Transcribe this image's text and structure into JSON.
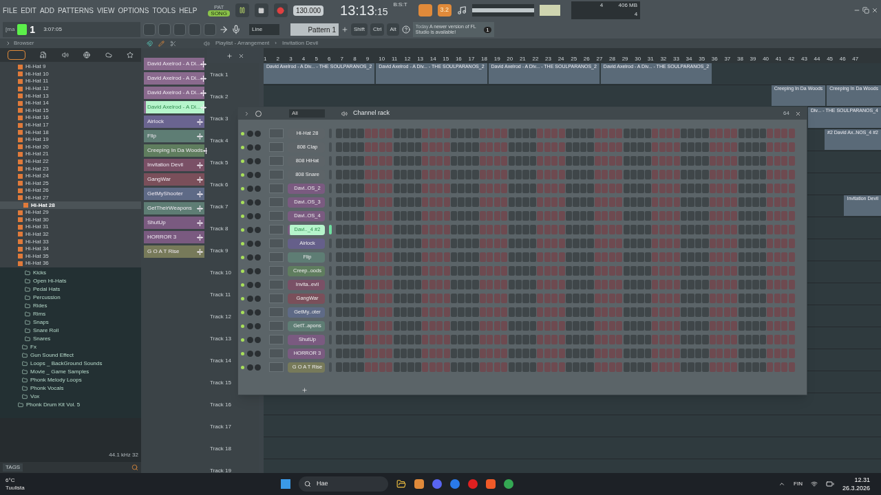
{
  "menu": [
    "FILE",
    "EDIT",
    "ADD",
    "PATTERNS",
    "VIEW",
    "OPTIONS",
    "TOOLS",
    "HELP"
  ],
  "transport": {
    "pat_label": "PAT",
    "song_label": "SONG",
    "song_mode": true,
    "tempo": "130.000",
    "time": "13:13",
    "time_small": ":15",
    "time_unit": "B:S:T",
    "step_label": "3.2"
  },
  "monitor": {
    "cpu": "4",
    "memory": "406 MB",
    "polyphony": "4"
  },
  "hint": {
    "text": "[ma",
    "time": "3:07:05",
    "logo_number": "1"
  },
  "toolbar": {
    "snap": "Line",
    "pattern": "Pattern 1",
    "keys": [
      "Shift",
      "Ctrl",
      "Alt"
    ]
  },
  "news": {
    "when": "Today",
    "text": "A newer version of FL Studio is available!",
    "badge": "1"
  },
  "browser": {
    "title": "Browser",
    "files": [
      {
        "label": "Hi-Hat 9",
        "selected": false
      },
      {
        "label": "Hi-Hat 10",
        "selected": false
      },
      {
        "label": "Hi-Hat 11",
        "selected": false
      },
      {
        "label": "Hi-Hat 12",
        "selected": false
      },
      {
        "label": "Hi-Hat 13",
        "selected": false
      },
      {
        "label": "Hi-Hat 14",
        "selected": false
      },
      {
        "label": "Hi-Hat 15",
        "selected": false
      },
      {
        "label": "Hi-Hat 16",
        "selected": false
      },
      {
        "label": "Hi-Hat 17",
        "selected": false
      },
      {
        "label": "Hi-Hat 18",
        "selected": false
      },
      {
        "label": "Hi-Hat 19",
        "selected": false
      },
      {
        "label": "Hi-Hat 20",
        "selected": false
      },
      {
        "label": "Hi-Hat 21",
        "selected": false
      },
      {
        "label": "Hi-Hat 22",
        "selected": false
      },
      {
        "label": "Hi-Hat 23",
        "selected": false
      },
      {
        "label": "Hi-Hat 24",
        "selected": false
      },
      {
        "label": "Hi-Hat 25",
        "selected": false
      },
      {
        "label": "Hi-Hat 26",
        "selected": false
      },
      {
        "label": "Hi-Hat 27",
        "selected": false
      },
      {
        "label": "Hi-Hat 28",
        "selected": true
      },
      {
        "label": "Hi-Hat 29",
        "selected": false
      },
      {
        "label": "Hi-Hat 30",
        "selected": false
      },
      {
        "label": "Hi-Hat 31",
        "selected": false
      },
      {
        "label": "Hi-Hat 32",
        "selected": false
      },
      {
        "label": "Hi-Hat 33",
        "selected": false
      },
      {
        "label": "Hi-Hat 34",
        "selected": false
      },
      {
        "label": "Hi-Hat 35",
        "selected": false
      },
      {
        "label": "Hi-Hat 36",
        "selected": false
      }
    ],
    "subfolders": [
      "Kicks",
      "Open Hi-Hats",
      "Pedal Hats",
      "Percussion",
      "Rides",
      "Rims",
      "Snaps",
      "Snare Roll",
      "Snares"
    ],
    "folders": [
      "Fx",
      "Gun Sound Effect",
      "Loops _ BackGround Sounds",
      "Movie _ Game Samples",
      "Phonk Melody Loops",
      "Phonk Vocals",
      "Vox"
    ],
    "root_folders": [
      "Phonk Drum Kit Vol. 5"
    ],
    "sample_info": "44.1 kHz 32",
    "tags_label": "TAGS"
  },
  "playlist": {
    "title": "Playlist - Arrangement",
    "separator": "›",
    "arrangement": "Invitation Devil",
    "ruler": [
      "1",
      "2",
      "3",
      "4",
      "5",
      "6",
      "7",
      "8",
      "9",
      "10",
      "11",
      "12",
      "13",
      "14",
      "15",
      "16",
      "17",
      "18",
      "19",
      "20",
      "21",
      "22",
      "23",
      "24",
      "25",
      "26",
      "27",
      "28",
      "29",
      "30",
      "31",
      "32",
      "33",
      "34",
      "35",
      "36",
      "37",
      "38",
      "39",
      "40",
      "41",
      "42",
      "43",
      "44",
      "45",
      "46",
      "47"
    ],
    "tracks": [
      {
        "name": "Track 1",
        "clips": [
          "David Axelrod - A Div... - THE SOULPARANOS_2",
          "David Axelrod - A Div... - THE SOULPARANOS_2",
          "David Axelrod - A Div... - THE SOULPARANOS_2",
          "David Axelrod - A Div... - THE SOULPARANOS_2"
        ]
      },
      {
        "name": "Track 2",
        "clips": [
          "Creeping In Da Woods",
          "Creeping In Da Woods"
        ]
      },
      {
        "name": "Track 3",
        "clips": [
          "Div... - THE SOULPARANOS_4"
        ]
      },
      {
        "name": "Track 4",
        "clips": [
          "#2 David Ax..NOS_4 #2"
        ]
      },
      {
        "name": "Track 5"
      },
      {
        "name": "Track 6"
      },
      {
        "name": "Track 7",
        "clips": [
          "Invitation Devil"
        ]
      },
      {
        "name": "Track 8"
      },
      {
        "name": "Track 9"
      },
      {
        "name": "Track 10"
      },
      {
        "name": "Track 11"
      },
      {
        "name": "Track 12"
      },
      {
        "name": "Track 13"
      },
      {
        "name": "Track 14"
      },
      {
        "name": "Track 15"
      },
      {
        "name": "Track 16"
      },
      {
        "name": "Track 17"
      },
      {
        "name": "Track 18"
      },
      {
        "name": "Track 19"
      }
    ]
  },
  "picker": [
    {
      "label": "David Axelrod - A Di...",
      "color": "#8a6a8e",
      "selected": false
    },
    {
      "label": "David Axelrod - A Di...",
      "color": "#8a6a8e",
      "selected": false
    },
    {
      "label": "David Axelrod - A Di...",
      "color": "#8a6a8e",
      "selected": false
    },
    {
      "label": "David Axelrod - A Di...",
      "color": "#8a6a8e",
      "selected": true
    },
    {
      "label": "Airlock",
      "color": "#6a6490",
      "selected": false
    },
    {
      "label": "Flip",
      "color": "#5e7d74",
      "selected": false
    },
    {
      "label": "Creeping In Da Woods",
      "color": "#5f7d5e",
      "selected": false
    },
    {
      "label": "Invitation Devil",
      "color": "#7a5066",
      "selected": false
    },
    {
      "label": "GangWar",
      "color": "#7a4f5a",
      "selected": false
    },
    {
      "label": "GetMyShooter",
      "color": "#5e6a86",
      "selected": false
    },
    {
      "label": "GetTheirWeapons",
      "color": "#5e7d74",
      "selected": false
    },
    {
      "label": "ShutUp",
      "color": "#7a5a80",
      "selected": false
    },
    {
      "label": "HORROR 3",
      "color": "#7a5a80",
      "selected": false
    },
    {
      "label": "G O A T Rise",
      "color": "#777a5a",
      "selected": false
    }
  ],
  "channel_rack": {
    "title": "Channel rack",
    "filter": "All",
    "steps": "64",
    "channels": [
      {
        "name": "Hi-Hat 28",
        "color": "#5d6468",
        "selected": false
      },
      {
        "name": "808 Clap",
        "color": "#5d6468",
        "selected": false
      },
      {
        "name": "808 HiHat",
        "color": "#5d6468",
        "selected": false
      },
      {
        "name": "808 Snare",
        "color": "#5d6468",
        "selected": false
      },
      {
        "name": "Davi..OS_2",
        "color": "#7a5a80",
        "selected": false
      },
      {
        "name": "Davi..OS_3",
        "color": "#7a5a80",
        "selected": false
      },
      {
        "name": "Davi..OS_4",
        "color": "#7a5a80",
        "selected": false
      },
      {
        "name": "Davi.._4 #2",
        "color": "#7a5a80",
        "selected": true
      },
      {
        "name": "Airlock",
        "color": "#655f8a",
        "selected": false
      },
      {
        "name": "Flip",
        "color": "#5e7d74",
        "selected": false
      },
      {
        "name": "Creep..oods",
        "color": "#5f7d5e",
        "selected": false
      },
      {
        "name": "Invita..evil",
        "color": "#7a5066",
        "selected": false
      },
      {
        "name": "GangWar",
        "color": "#7a4f5a",
        "selected": false
      },
      {
        "name": "GetMy..oter",
        "color": "#5e6a86",
        "selected": false
      },
      {
        "name": "GetT..apons",
        "color": "#5e7d74",
        "selected": false
      },
      {
        "name": "ShutUp",
        "color": "#7a5a80",
        "selected": false
      },
      {
        "name": "HORROR 3",
        "color": "#7a5a80",
        "selected": false
      },
      {
        "name": "G O A T Rise",
        "color": "#777a5a",
        "selected": false
      }
    ]
  },
  "taskbar": {
    "temperature": "6°C",
    "weather": "Tuulista",
    "search": "Hae",
    "language": "FIN",
    "time": "12.31",
    "date": "26.3.2026"
  }
}
